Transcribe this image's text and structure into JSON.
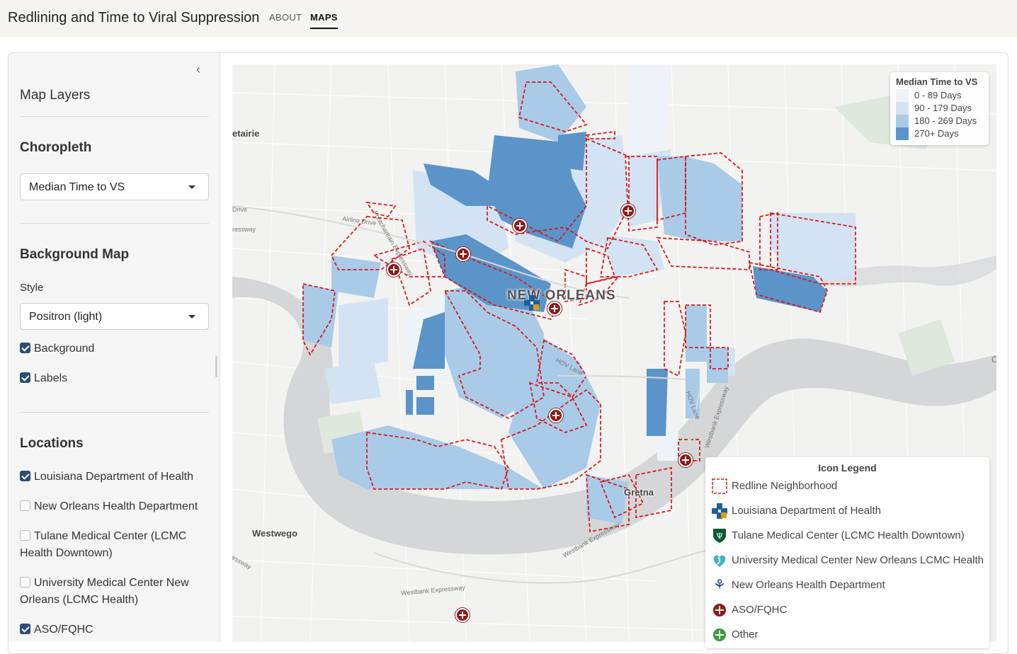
{
  "header": {
    "title": "Redlining and Time to Viral Suppression",
    "nav": [
      {
        "label": "ABOUT",
        "active": false
      },
      {
        "label": "MAPS",
        "active": true
      }
    ]
  },
  "sidebar": {
    "collapse_icon": "chevron-left-icon",
    "heading": "Map Layers",
    "choropleth": {
      "title": "Choropleth",
      "selected": "Median Time to VS"
    },
    "background_map": {
      "title": "Background Map",
      "style_label": "Style",
      "style_selected": "Positron (light)",
      "background": {
        "label": "Background",
        "checked": true
      },
      "labels": {
        "label": "Labels",
        "checked": true
      }
    },
    "locations": {
      "title": "Locations",
      "items": [
        {
          "label": "Louisiana Department of Health",
          "checked": true
        },
        {
          "label": "New Orleans Health Department",
          "checked": false
        },
        {
          "label": "Tulane Medical Center (LCMC Health Downtown)",
          "checked": false
        },
        {
          "label": "University Medical Center New Orleans (LCMC Health)",
          "checked": false
        },
        {
          "label": "ASO/FQHC",
          "checked": true
        }
      ]
    }
  },
  "map": {
    "places": {
      "metairie": "etairie",
      "new_orleans": "NEW ORLEANS",
      "westwego": "Westwego",
      "gretna": "Gretna"
    },
    "roads": {
      "pontchartrain": "Pontchartrain Expressway",
      "airline": "Airline Drive",
      "drive": "Drive",
      "expressway_w": "ressway",
      "hov1": "HOV Lane",
      "hov2": "HOV Lane",
      "westbank_exp1": "Westbank Expressway",
      "westbank_exp2": "Westbank Expressway",
      "westbank_exp3": "Westbank Expressway",
      "expressway_sw": "ressway",
      "far_right": "C"
    },
    "colors": {
      "water": "#d4d6d8",
      "land": "#f2f2f0",
      "redline": "#d7191c",
      "bin0": "#eef3fa",
      "bin1": "#d3e3f3",
      "bin2": "#a9cbe8",
      "bin3": "#5b94c9"
    }
  },
  "legend_vs": {
    "title": "Median Time to VS",
    "bins": [
      {
        "label": "0 - 89 Days",
        "color": "#eef3fa"
      },
      {
        "label": "90 - 179 Days",
        "color": "#d3e3f3"
      },
      {
        "label": "180 - 269 Days",
        "color": "#a9cbe8"
      },
      {
        "label": "270+ Days",
        "color": "#5b94c9"
      }
    ]
  },
  "legend_icons": {
    "title": "Icon Legend",
    "items": [
      {
        "label": "Redline Neighborhood",
        "icon": "redline-box-icon"
      },
      {
        "label": "Louisiana Department of Health",
        "icon": "ldh-cross-icon"
      },
      {
        "label": "Tulane Medical Center (LCMC Health Downtown)",
        "icon": "tulane-shield-icon"
      },
      {
        "label": "University Medical Center New Orleans LCMC Health",
        "icon": "umc-heart-icon"
      },
      {
        "label": "New Orleans Health Department",
        "icon": "fleur-de-lis-icon"
      },
      {
        "label": "ASO/FQHC",
        "icon": "red-cross-icon"
      },
      {
        "label": "Other",
        "icon": "green-cross-icon"
      }
    ]
  }
}
